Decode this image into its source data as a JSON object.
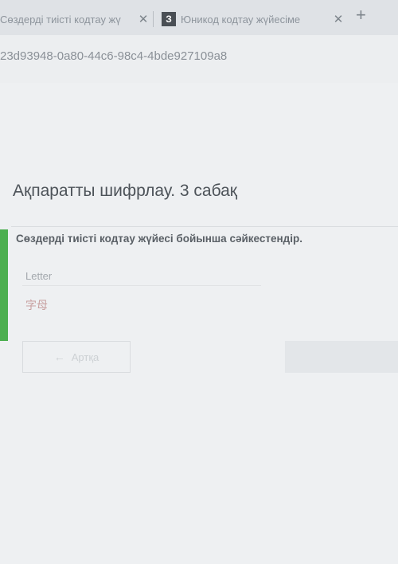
{
  "browser": {
    "tabs": [
      {
        "label": "Сөздерді тиісті кодтау жү",
        "close": "✕"
      },
      {
        "label": "Юникод кодтау жүйесіме",
        "favicon": "З",
        "close": "✕"
      }
    ],
    "new_tab": "+",
    "url": "23d93948-0a80-44c6-98c4-4bde927109a8"
  },
  "lesson": {
    "title": "Ақпаратты шифрлау. 3 сабақ",
    "question": "Сөздерді тиісті кодтау жүйесі бойынша сәйкестендір.",
    "word_label": "Letter",
    "word_value": "字母"
  },
  "nav": {
    "back_label": "Артқа",
    "back_icon": "←"
  },
  "colors": {
    "accent": "#4caf50"
  }
}
